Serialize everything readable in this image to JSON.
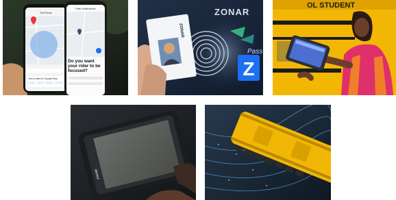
{
  "tiles": [
    {
      "id": "phone-app",
      "phone_left_title": "Set Route",
      "phone_right_title": "Rider Notifications",
      "phone_prompt": "Do you want your rider to be focused?",
      "phone_card_title": "Set a Letter for Focused Stop",
      "phone_buttons": [
        "Any",
        "Focus",
        "Pick Up",
        "Drop Off"
      ]
    },
    {
      "id": "zpass-card",
      "card_brand": "ZONAR",
      "reader_brand": "ZONAR",
      "badge_letter": "Z",
      "badge_text": "Pass"
    },
    {
      "id": "bus-tablet",
      "bus_text": "OL STUDENT"
    },
    {
      "id": "rugged-tablet",
      "brand": "zonar"
    },
    {
      "id": "bus-aerial"
    }
  ],
  "colors": {
    "bus_yellow": "#f2b705",
    "vest_orange": "#f07f2a",
    "shirt_pink": "#e0306b",
    "zonar_green": "#36c98b",
    "zonar_blue": "#1d6ff2",
    "map_blue": "#7fb1e8"
  }
}
